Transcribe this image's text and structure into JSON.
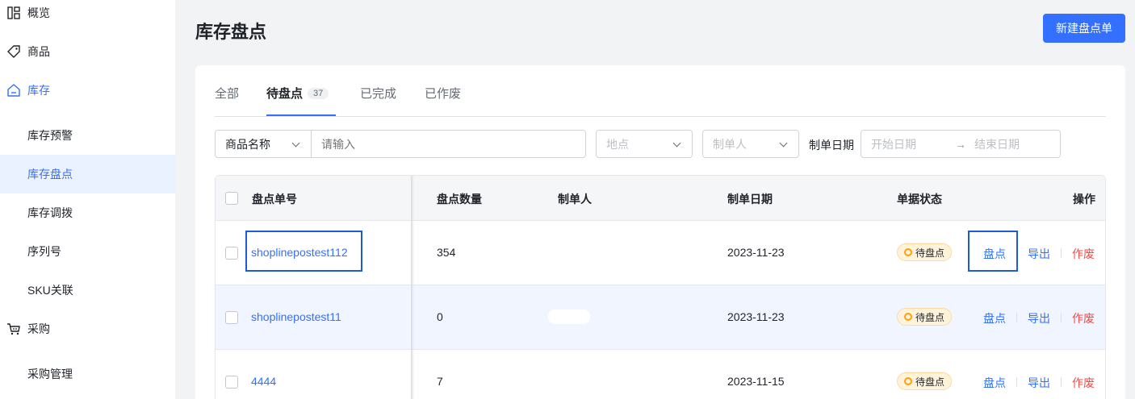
{
  "sidebar": {
    "items": [
      {
        "label": "概览",
        "icon": "dashboard-icon"
      },
      {
        "label": "商品",
        "icon": "tag-icon"
      },
      {
        "label": "库存",
        "icon": "warehouse-icon"
      },
      {
        "label": "库存预警"
      },
      {
        "label": "库存盘点"
      },
      {
        "label": "库存调拨"
      },
      {
        "label": "序列号"
      },
      {
        "label": "SKU关联"
      },
      {
        "label": "采购",
        "icon": "cart-icon"
      },
      {
        "label": "采购管理"
      }
    ]
  },
  "header": {
    "title": "库存盘点",
    "new_button": "新建盘点单"
  },
  "tabs": [
    {
      "label": "全部"
    },
    {
      "label": "待盘点",
      "badge": "37"
    },
    {
      "label": "已完成"
    },
    {
      "label": "已作废"
    }
  ],
  "filters": {
    "field_select": "商品名称",
    "keyword_placeholder": "请输入",
    "location_placeholder": "地点",
    "creator_placeholder": "制单人",
    "date_label": "制单日期",
    "start_placeholder": "开始日期",
    "end_placeholder": "结束日期"
  },
  "table": {
    "columns": [
      "盘点单号",
      "盘点数量",
      "制单人",
      "制单日期",
      "单据状态",
      "操作"
    ],
    "rows": [
      {
        "id": "shoplinepostest112",
        "qty": "354",
        "creator": "",
        "date": "2023-11-23",
        "status": "待盘点",
        "ops": [
          "盘点",
          "导出",
          "作废"
        ]
      },
      {
        "id": "shoplinepostest11",
        "qty": "0",
        "creator": "",
        "date": "2023-11-23",
        "status": "待盘点",
        "ops": [
          "盘点",
          "导出",
          "作废"
        ]
      },
      {
        "id": "4444",
        "qty": "7",
        "creator": "",
        "date": "2023-11-15",
        "status": "待盘点",
        "ops": [
          "盘点",
          "导出",
          "作废"
        ]
      }
    ]
  },
  "colors": {
    "accent": "#3370ff",
    "danger": "#f54a45",
    "pending": "#ff9f0a"
  }
}
